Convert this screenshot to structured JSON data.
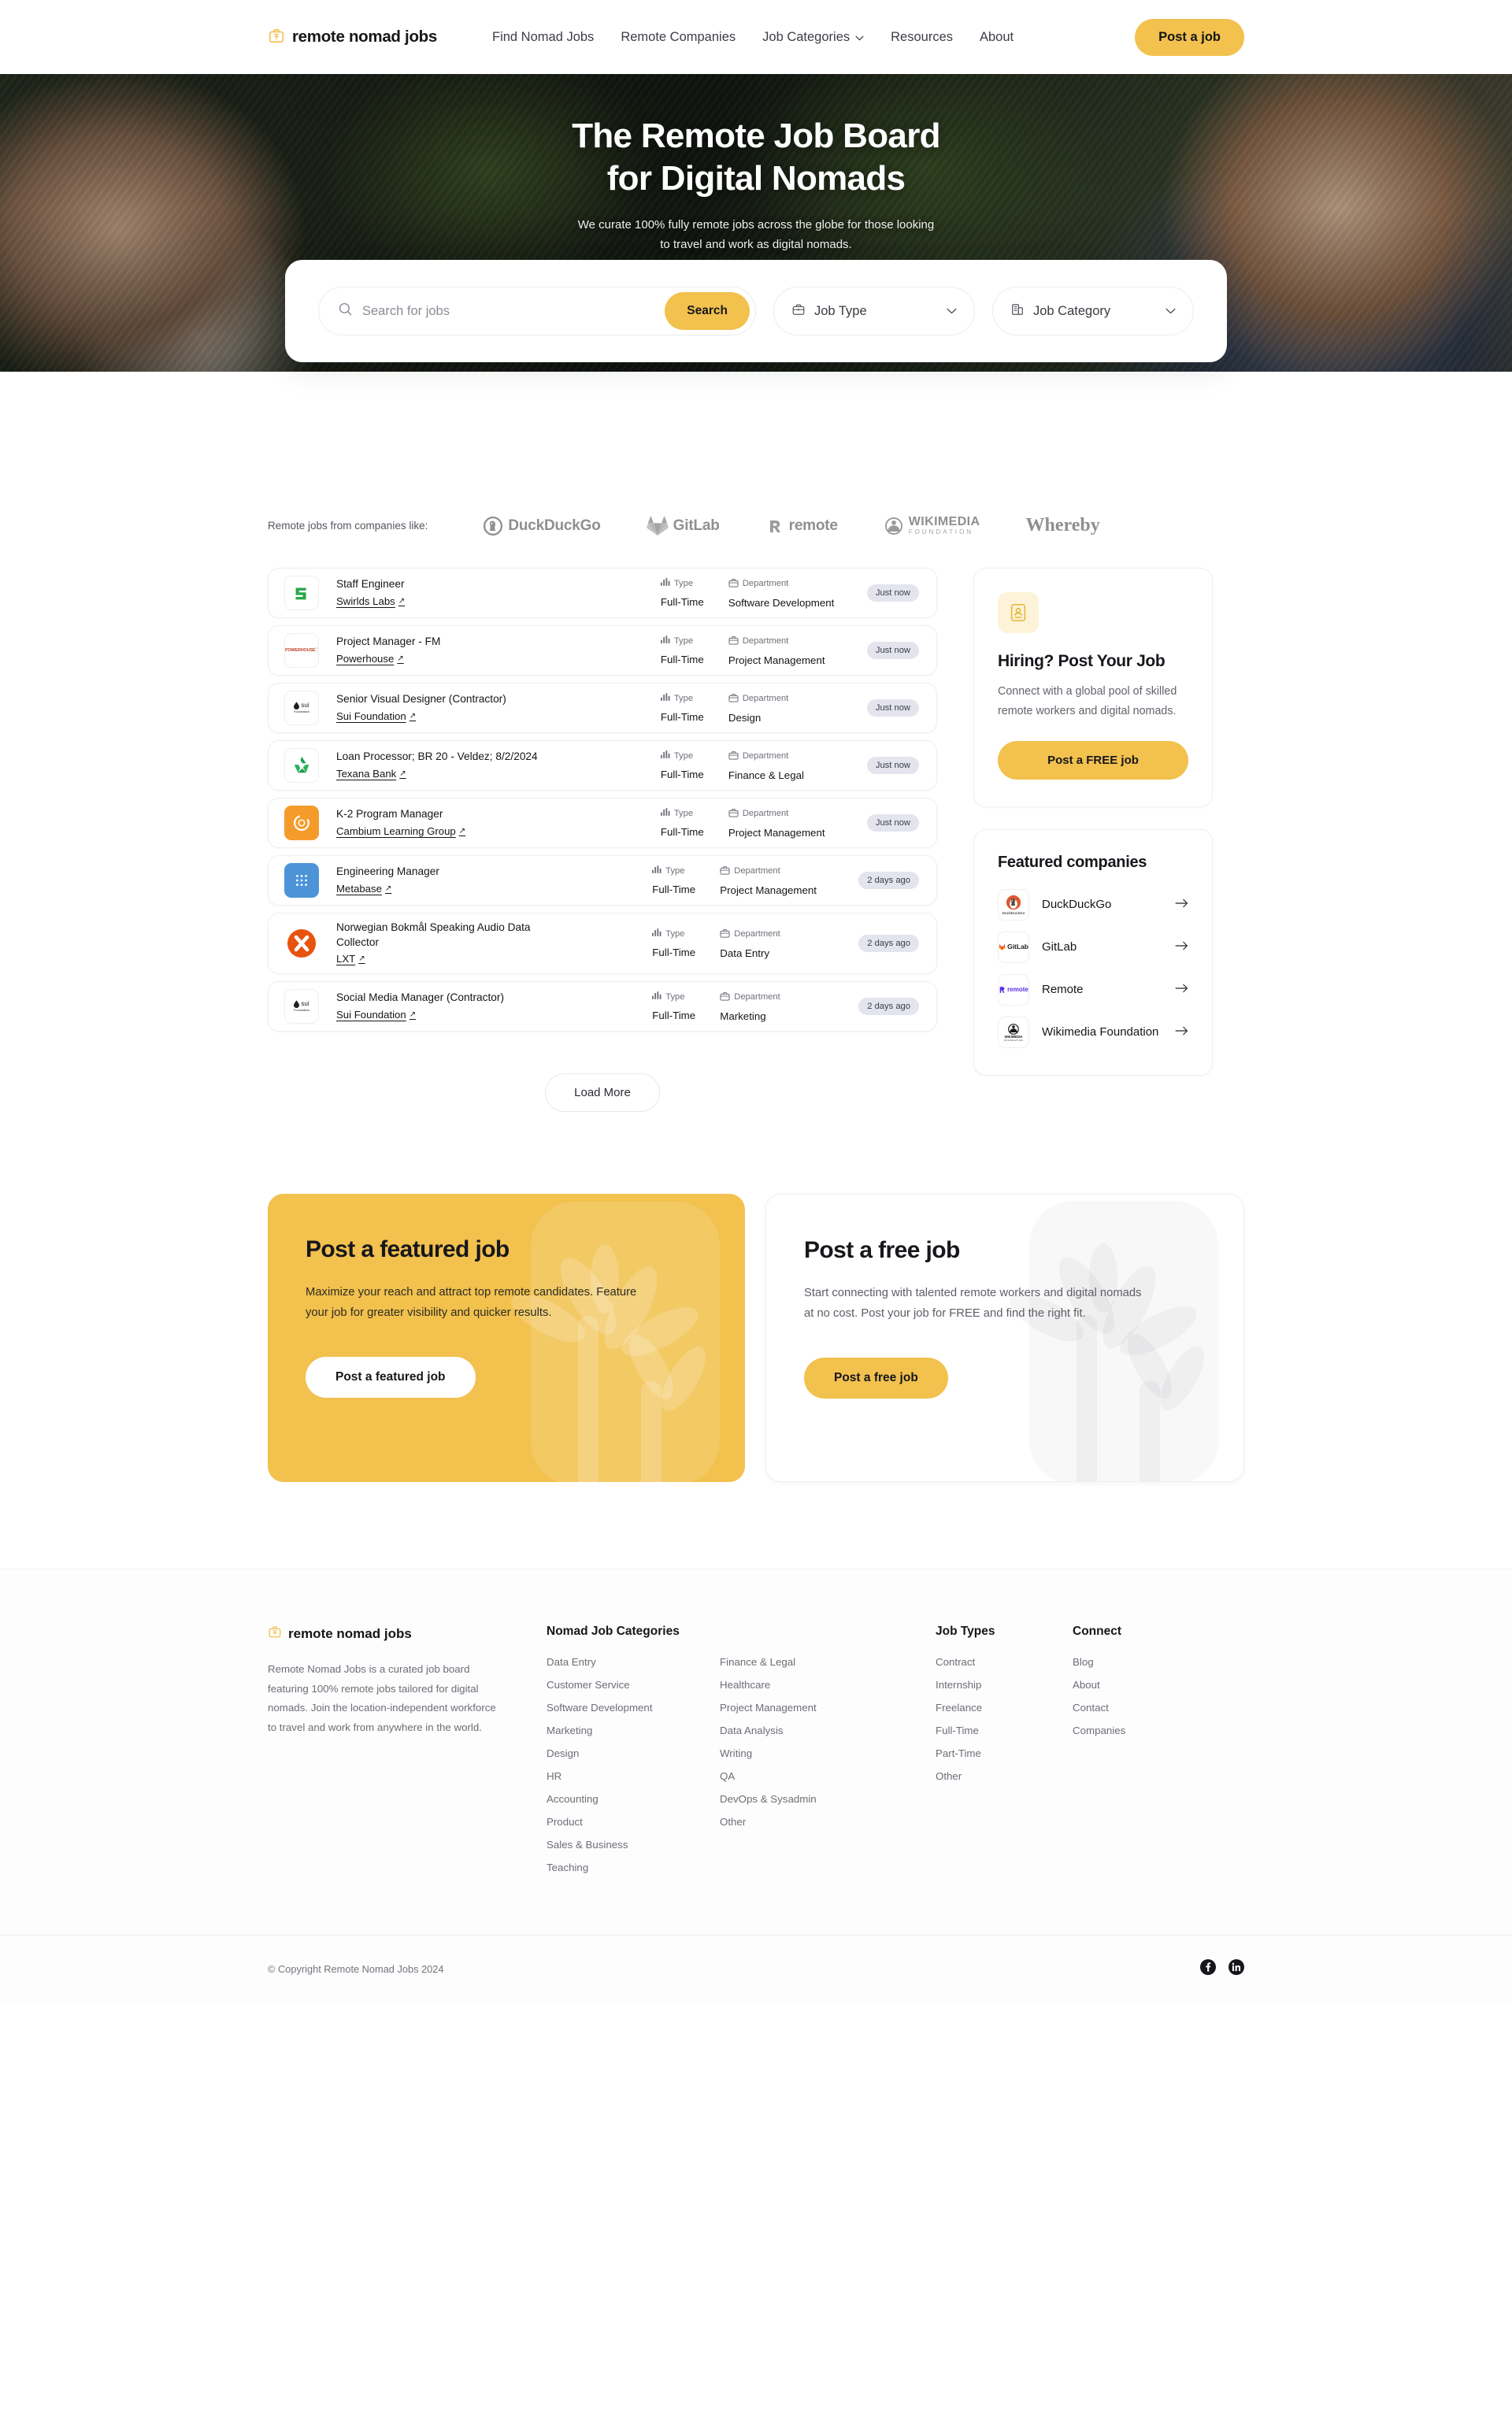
{
  "brand": {
    "name": "remote nomad jobs",
    "logo_icon": "briefcase-palm-icon",
    "accent": "#F2C14E"
  },
  "header": {
    "nav": [
      {
        "label": "Find Nomad Jobs",
        "has_chevron": false
      },
      {
        "label": "Remote Companies",
        "has_chevron": false
      },
      {
        "label": "Job Categories",
        "has_chevron": true
      },
      {
        "label": "Resources",
        "has_chevron": false
      },
      {
        "label": "About",
        "has_chevron": false
      }
    ],
    "cta": "Post a job"
  },
  "hero": {
    "title_line1": "The Remote Job Board",
    "title_line2": "for Digital Nomads",
    "sub_line1": "We curate 100% fully remote jobs across the globe for those looking",
    "sub_line2": "to travel and work as digital nomads."
  },
  "search": {
    "placeholder": "Search for jobs",
    "value": "",
    "button": "Search",
    "job_type": {
      "label": "Job Type",
      "icon": "briefcase-icon"
    },
    "job_category": {
      "label": "Job Category",
      "icon": "building-icon"
    }
  },
  "logo_strip": {
    "label": "Remote jobs from companies like:",
    "companies": [
      "DuckDuckGo",
      "GitLab",
      "remote",
      "WIKIMEDIA FOUNDATION",
      "Whereby"
    ]
  },
  "jobs": {
    "meta_labels": {
      "type": "Type",
      "department": "Department"
    },
    "items": [
      {
        "title": "Staff Engineer",
        "company": "Swirlds Labs",
        "type": "Full-Time",
        "department": "Software Development",
        "posted": "Just now",
        "logo_text": "S",
        "logo_bg": "#ffffff",
        "logo_fg": "#2aa74a"
      },
      {
        "title": "Project Manager - FM",
        "company": "Powerhouse",
        "type": "Full-Time",
        "department": "Project Management",
        "posted": "Just now",
        "logo_text": "POWERHOUSE",
        "logo_bg": "#ffffff",
        "logo_fg": "#c2462b"
      },
      {
        "title": "Senior Visual Designer (Contractor)",
        "company": "Sui Foundation",
        "type": "Full-Time",
        "department": "Design",
        "posted": "Just now",
        "logo_text": "sui Foundation",
        "logo_bg": "#ffffff",
        "logo_fg": "#1f1f24"
      },
      {
        "title": "Loan Processor; BR 20 - Veldez; 8/2/2024",
        "company": "Texana Bank",
        "type": "Full-Time",
        "department": "Finance & Legal",
        "posted": "Just now",
        "logo_text": "T",
        "logo_bg": "#ffffff",
        "logo_fg": "#1d9b4f"
      },
      {
        "title": "K-2 Program Manager",
        "company": "Cambium Learning Group",
        "type": "Full-Time",
        "department": "Project Management",
        "posted": "Just now",
        "logo_text": "C",
        "logo_bg": "#f59b2a",
        "logo_fg": "#ffffff"
      },
      {
        "title": "Engineering Manager",
        "company": "Metabase",
        "type": "Full-Time",
        "department": "Project Management",
        "posted": "2 days ago",
        "logo_text": "M",
        "logo_bg": "#4c93d8",
        "logo_fg": "#ffffff"
      },
      {
        "title": "Norwegian Bokmål Speaking Audio Data Collector",
        "company": "LXT",
        "type": "Full-Time",
        "department": "Data Entry",
        "posted": "2 days ago",
        "logo_text": "X",
        "logo_bg": "#e8530e",
        "logo_fg": "#ffffff"
      },
      {
        "title": "Social Media Manager (Contractor)",
        "company": "Sui Foundation",
        "type": "Full-Time",
        "department": "Marketing",
        "posted": "2 days ago",
        "logo_text": "sui Foundation",
        "logo_bg": "#ffffff",
        "logo_fg": "#1f1f24"
      }
    ],
    "load_more": "Load More"
  },
  "hiring_card": {
    "icon": "id-badge-icon",
    "title": "Hiring? Post Your Job",
    "text": "Connect with a global pool of skilled remote workers and digital nomads.",
    "button": "Post a FREE job"
  },
  "featured": {
    "title": "Featured companies",
    "items": [
      {
        "name": "DuckDuckGo",
        "logo_text": "DuckDuckGo"
      },
      {
        "name": "GitLab",
        "logo_text": "GitLab"
      },
      {
        "name": "Remote",
        "logo_text": "remote"
      },
      {
        "name": "Wikimedia Foundation",
        "logo_text": "WIKIMEDIA FOUNDATION"
      }
    ]
  },
  "promos": [
    {
      "title": "Post a featured job",
      "text": "Maximize your reach and attract top remote candidates. Feature your job for greater visibility and quicker results.",
      "button": "Post a featured job",
      "style": "yellow"
    },
    {
      "title": "Post a free job",
      "text": "Start connecting with talented remote workers and digital nomads at no cost. Post your job for FREE and find the right fit.",
      "button": "Post a free job",
      "style": "white"
    }
  ],
  "footer": {
    "brand_name": "remote nomad jobs",
    "description": "Remote Nomad Jobs is a curated job board featuring 100% remote jobs tailored for digital nomads. Join the location-independent workforce to travel and work from anywhere in the world.",
    "categories_head": "Nomad Job Categories",
    "categories_col1": [
      "Data Entry",
      "Customer Service",
      "Software Development",
      "Marketing",
      "Design",
      "HR",
      "Accounting",
      "Product",
      "Sales & Business",
      "Teaching"
    ],
    "categories_col2": [
      "Finance & Legal",
      "Healthcare",
      "Project Management",
      "Data Analysis",
      "Writing",
      "QA",
      "DevOps & Sysadmin",
      "Other"
    ],
    "types_head": "Job Types",
    "types": [
      "Contract",
      "Internship",
      "Freelance",
      "Full-Time",
      "Part-Time",
      "Other"
    ],
    "connect_head": "Connect",
    "connect": [
      "Blog",
      "About",
      "Contact",
      "Companies"
    ],
    "copyright": "© Copyright Remote Nomad Jobs 2024",
    "socials": [
      "facebook-icon",
      "linkedin-icon"
    ]
  }
}
